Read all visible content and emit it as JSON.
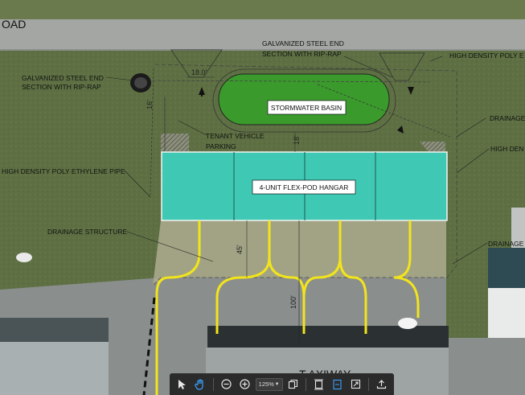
{
  "map": {
    "road_label": "OAD",
    "taxiway_partial": "T AXIWAY",
    "labels": {
      "galv_left": [
        "GALVANIZED STEEL END",
        "SECTION WITH RIP-RAP"
      ],
      "galv_top": [
        "GALVANIZED STEEL END",
        "SECTION WITH RIP-RAP"
      ],
      "hdpe_right": "HIGH DENSITY POLY E",
      "drainage_right_top": "DRAINAGE",
      "high_den_right": "HIGH DEN",
      "hdpe_left": "HIGH DENSITY POLY ETHYLENE PIPE",
      "tenant_parking": [
        "TENANT VEHICLE",
        "PARKING"
      ],
      "drainage_left": "DRAINAGE STRUCTURE",
      "drainage_right_bottom": "DRAINAGE"
    },
    "boxes": {
      "stormwater": "STORMWATER BASIN",
      "hangar": "4-UNIT FLEX-POD HANGAR"
    },
    "dimensions": {
      "top": "18.0'",
      "left_vertical": "16'",
      "mid": "18'",
      "apron": "45'",
      "taxi": "100'"
    }
  },
  "toolbar": {
    "zoom_value": "125%",
    "tools": [
      "select-pointer",
      "hand-pan",
      "zoom-out",
      "zoom-in",
      "zoom-level",
      "copy",
      "fit-page",
      "fit-width",
      "fullscreen",
      "export"
    ]
  },
  "colors": {
    "hangar": "#3fc9b4",
    "basin": "#3a9a2c",
    "taxi_line": "#f2e41c",
    "toolbar_bg": "#2b2b2b",
    "active_tool": "#3aa0ff"
  }
}
